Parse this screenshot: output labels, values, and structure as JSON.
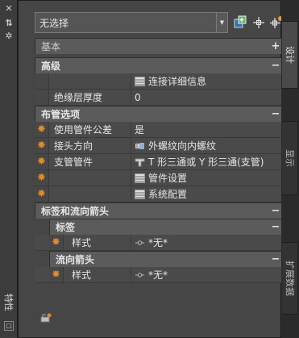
{
  "palette_title": "特性",
  "selector": {
    "value": "无选择"
  },
  "tabs": [
    {
      "label": "设计"
    },
    {
      "label": "显示"
    },
    {
      "label": "扩展数据"
    }
  ],
  "categories": {
    "basic": {
      "label": "基本",
      "toggle": "+"
    },
    "advanced": {
      "label": "高级",
      "toggle": "−"
    },
    "routing": {
      "label": "布管选项",
      "toggle": "−"
    },
    "labels_flow": {
      "label": "标签和流向箭头",
      "toggle": "−"
    },
    "labels": {
      "label": "标签",
      "toggle": "−"
    },
    "flow": {
      "label": "流向箭头",
      "toggle": "−"
    }
  },
  "advanced_rows": [
    {
      "name": "",
      "value": "连接详细信息",
      "icon": "table-icon"
    },
    {
      "name": "绝缘层厚度",
      "value": "0",
      "icon": ""
    }
  ],
  "routing_rows": [
    {
      "name": "使用管件公差",
      "value": "是",
      "icon": ""
    },
    {
      "name": "接头方向",
      "value": "外螺纹向内螺纹",
      "icon": "pipe-joint-icon"
    },
    {
      "name": "支管管件",
      "value": "T 形三通或 Y 形三通(支管)",
      "icon": "tee-icon"
    },
    {
      "name": "",
      "value": "管件设置",
      "icon": "table-icon"
    },
    {
      "name": "",
      "value": "系统配置",
      "icon": "table-icon"
    }
  ],
  "labels_rows": [
    {
      "name": "样式",
      "value": "*无*",
      "icon": "style-icon"
    }
  ],
  "flow_rows": [
    {
      "name": "样式",
      "value": "*无*",
      "icon": "style-icon"
    }
  ],
  "colors": {
    "accent_mark": "#e08a2c",
    "panel_bg": "#464646",
    "category_bg": "#5b5b5b"
  }
}
